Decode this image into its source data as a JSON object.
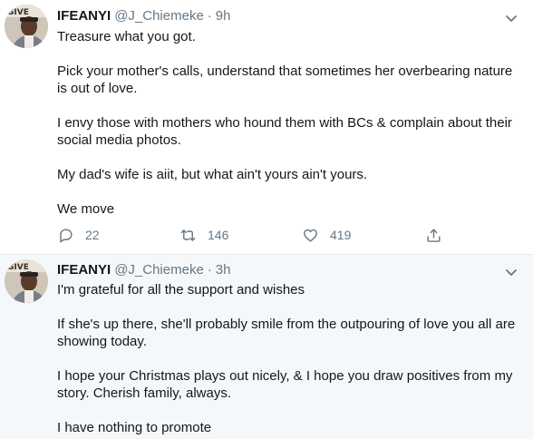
{
  "colors": {
    "text": "#14171a",
    "secondary": "#657786",
    "divider": "#e6ecf0",
    "highlight_bg": "#f5f8fa"
  },
  "tweets": [
    {
      "author_name": "IFEANYI",
      "handle": "@J_Chiemeke",
      "separator": "·",
      "time": "9h",
      "paragraphs": [
        "Treasure what you got.",
        "Pick your mother's calls, understand that sometimes her overbearing nature is out of love.",
        "I envy those with mothers who hound them with BCs & complain about their social media photos.",
        "My dad's wife is aiit, but what ain't yours ain't yours.",
        "We move"
      ],
      "stats": {
        "replies": "22",
        "retweets": "146",
        "likes": "419"
      },
      "icons": [
        "reply-icon",
        "retweet-icon",
        "like-icon",
        "share-icon",
        "chevron-down-icon"
      ]
    },
    {
      "author_name": "IFEANYI",
      "handle": "@J_Chiemeke",
      "separator": "·",
      "time": "3h",
      "paragraphs": [
        "I'm grateful for all the support and wishes",
        "If she's up there, she'll probably smile from the outpouring of love you all are showing today.",
        "I hope your Christmas plays out nicely, & I hope you draw positives from my story. Cherish family, always.",
        "I have nothing to promote"
      ],
      "icons": [
        "chevron-down-icon"
      ]
    }
  ]
}
